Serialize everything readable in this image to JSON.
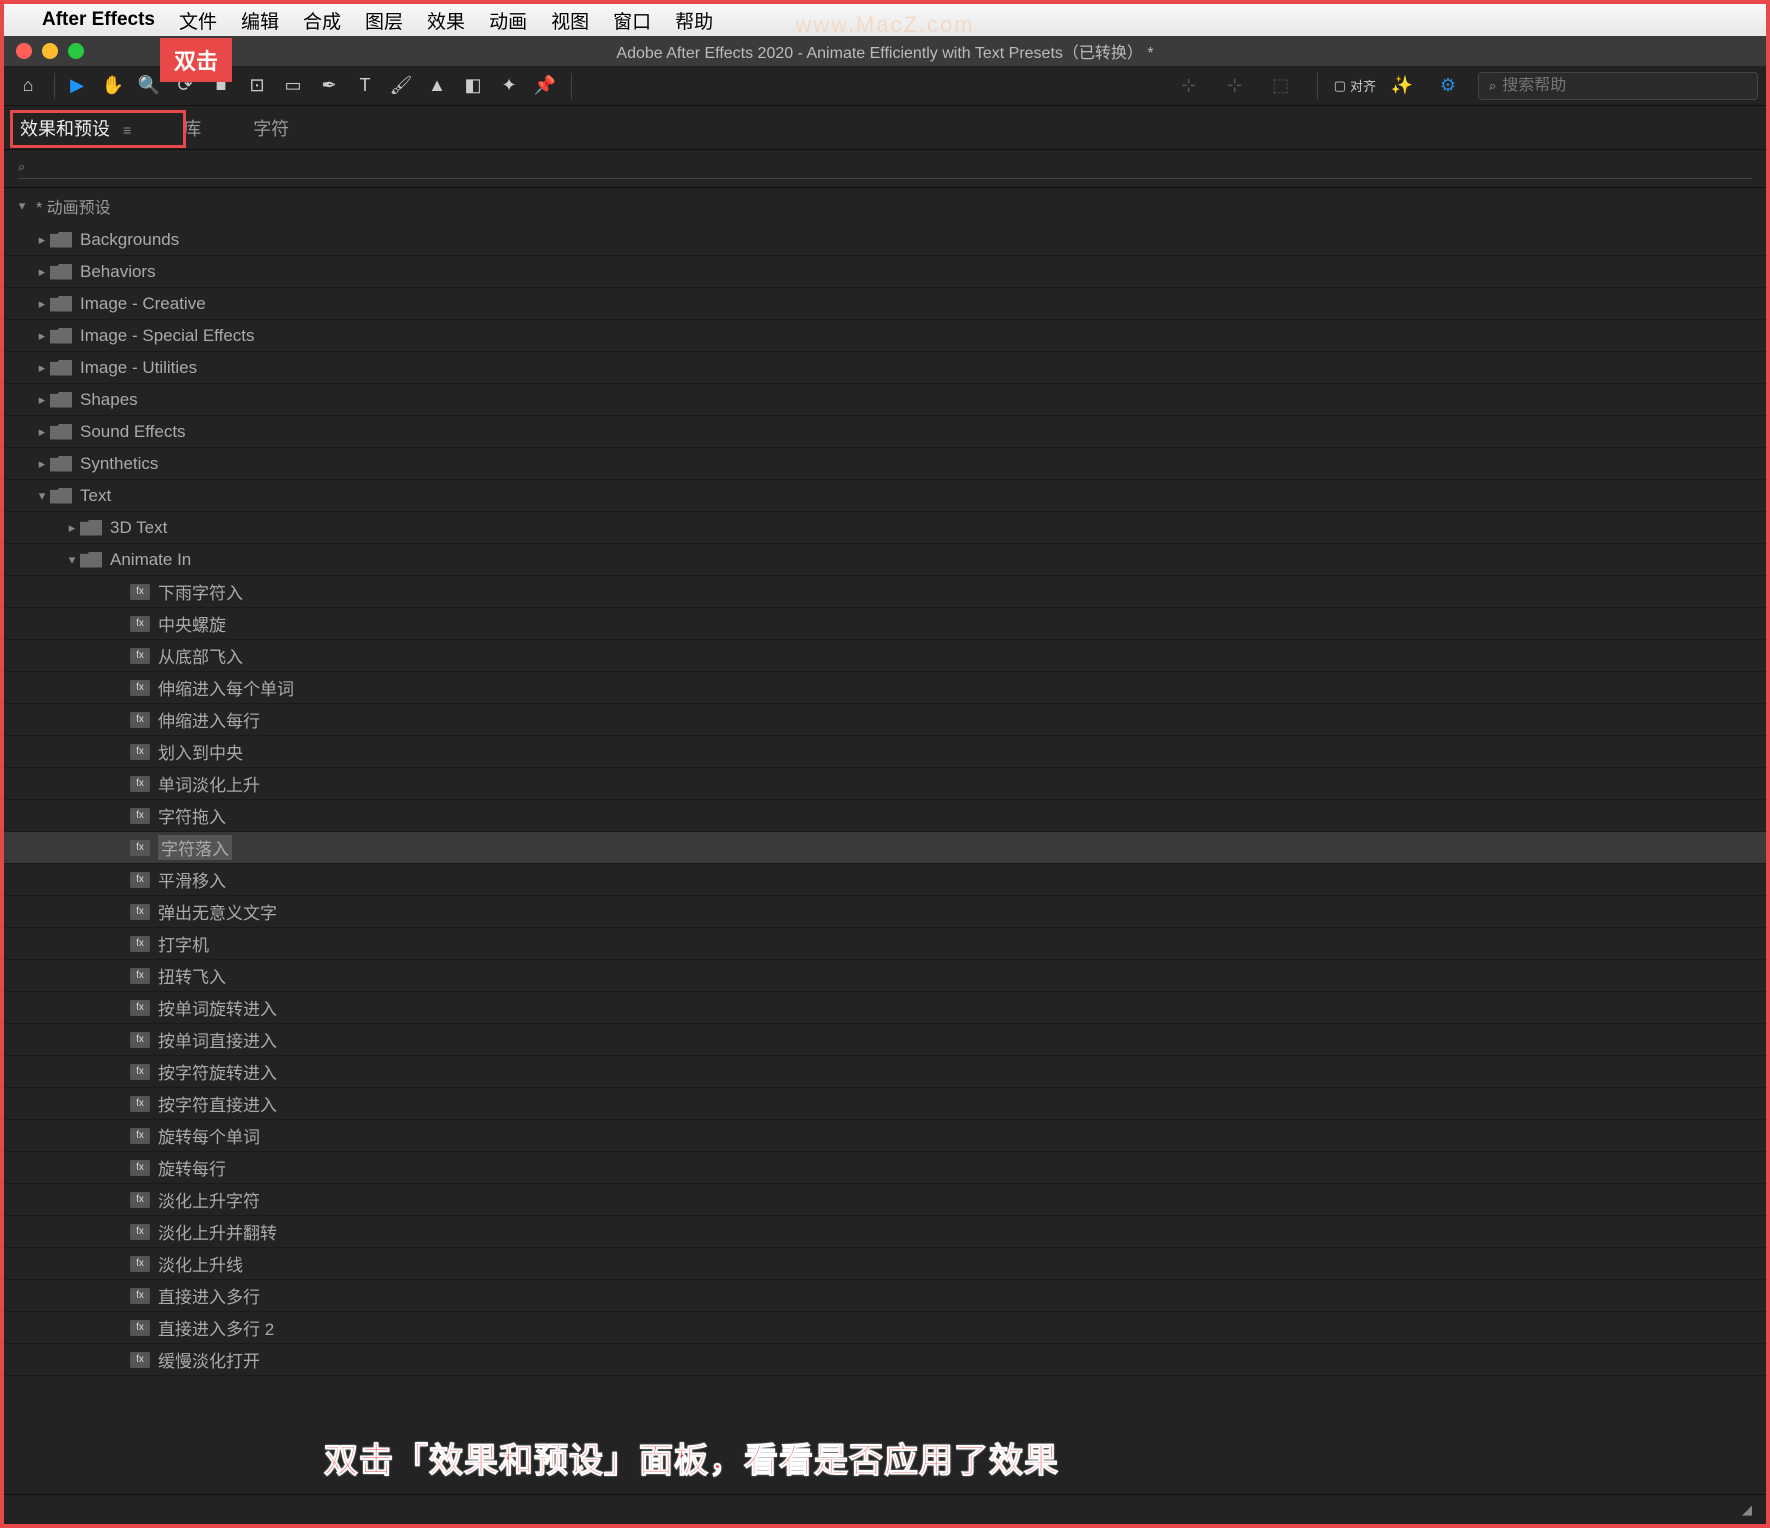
{
  "menubar": {
    "app_name": "After Effects",
    "items": [
      "文件",
      "编辑",
      "合成",
      "图层",
      "效果",
      "动画",
      "视图",
      "窗口",
      "帮助"
    ]
  },
  "watermark": "www.MacZ.com",
  "dbl_click_label": "双击",
  "window": {
    "title": "Adobe After Effects 2020 - Animate Efficiently with Text Presets（已转换） *"
  },
  "toolbar": {
    "align_label": "对齐",
    "search_placeholder": "搜索帮助"
  },
  "panel_tabs": {
    "active": "效果和预设",
    "tabs": [
      "效果和预设",
      "库",
      "字符"
    ]
  },
  "filter_icon": "⌕",
  "tree_header": "* 动画预设",
  "folders_level1": [
    {
      "label": "Backgrounds",
      "expanded": false
    },
    {
      "label": "Behaviors",
      "expanded": false
    },
    {
      "label": "Image - Creative",
      "expanded": false
    },
    {
      "label": "Image - Special Effects",
      "expanded": false
    },
    {
      "label": "Image - Utilities",
      "expanded": false
    },
    {
      "label": "Shapes",
      "expanded": false
    },
    {
      "label": "Sound Effects",
      "expanded": false
    },
    {
      "label": "Synthetics",
      "expanded": false
    },
    {
      "label": "Text",
      "expanded": true
    }
  ],
  "text_children": [
    {
      "label": "3D Text",
      "type": "folder",
      "expanded": false
    },
    {
      "label": "Animate In",
      "type": "folder",
      "expanded": true
    }
  ],
  "animate_in_presets": [
    "下雨字符入",
    "中央螺旋",
    "从底部飞入",
    "伸缩进入每个单词",
    "伸缩进入每行",
    "划入到中央",
    "单词淡化上升",
    "字符拖入",
    "字符落入",
    "平滑移入",
    "弹出无意义文字",
    "打字机",
    "扭转飞入",
    "按单词旋转进入",
    "按单词直接进入",
    "按字符旋转进入",
    "按字符直接进入",
    "旋转每个单词",
    "旋转每行",
    "淡化上升字符",
    "淡化上升并翻转",
    "淡化上升线",
    "直接进入多行",
    "直接进入多行 2",
    "缓慢淡化打开"
  ],
  "selected_preset": "字符落入",
  "annotation": "双击「效果和预设」面板，看看是否应用了效果"
}
